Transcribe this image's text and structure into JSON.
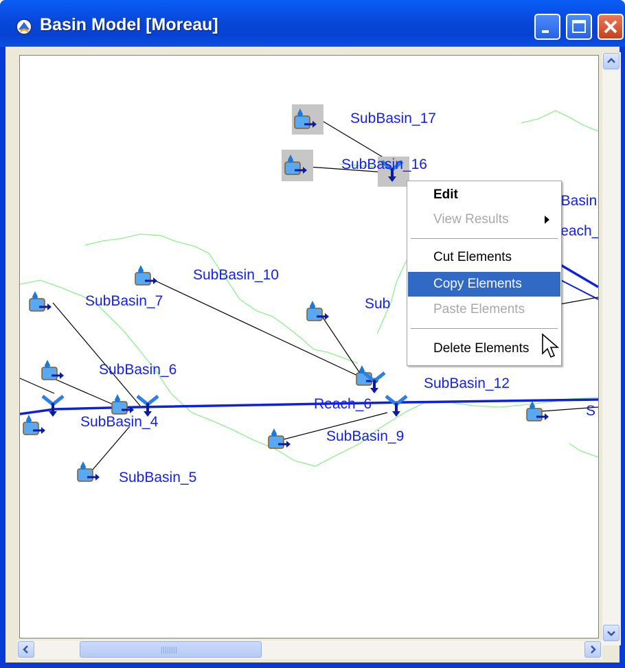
{
  "window": {
    "title": "Basin Model [Moreau]",
    "icon": "basin-model-icon",
    "controls": [
      "minimize-icon",
      "maximize-icon",
      "close-icon"
    ]
  },
  "map": {
    "labels": {
      "subbasin_17": "SubBasin_17",
      "subbasin_16": "SubBasin_16",
      "subbasin_10": "SubBasin_10",
      "subbasin_7": "SubBasin_7",
      "subbasin_6": "SubBasin_6",
      "subbasin_4": "SubBasin_4",
      "subbasin_5": "SubBasin_5",
      "subbasin_9": "SubBasin_9",
      "subbasin_12": "SubBasin_12",
      "reach_6": "Reach_6",
      "partial_sub": "Sub",
      "partial_obasin": "oBasin",
      "partial_reach": "Reach_",
      "partial_s": "S"
    },
    "colors": {
      "label": "#1420f0",
      "reach": "#0d20e0",
      "connector": "#000000",
      "boundary": "#8ef08e",
      "selection": "#c6c6c6"
    }
  },
  "context_menu": {
    "items": [
      {
        "label": "Edit",
        "state": "default"
      },
      {
        "label": "View Results",
        "state": "disabled",
        "submenu": true
      },
      {
        "label": "Cut Elements",
        "state": "enabled"
      },
      {
        "label": "Copy Elements",
        "state": "highlighted"
      },
      {
        "label": "Paste Elements",
        "state": "disabled"
      },
      {
        "label": "Delete Elements",
        "state": "enabled"
      }
    ],
    "highlight_color": "#316ac5"
  },
  "scrollbars": {
    "vertical": {
      "up": "chevron-up-icon",
      "down": "chevron-down-icon"
    },
    "horizontal": {
      "left": "chevron-left-icon",
      "right": "chevron-right-icon"
    }
  }
}
